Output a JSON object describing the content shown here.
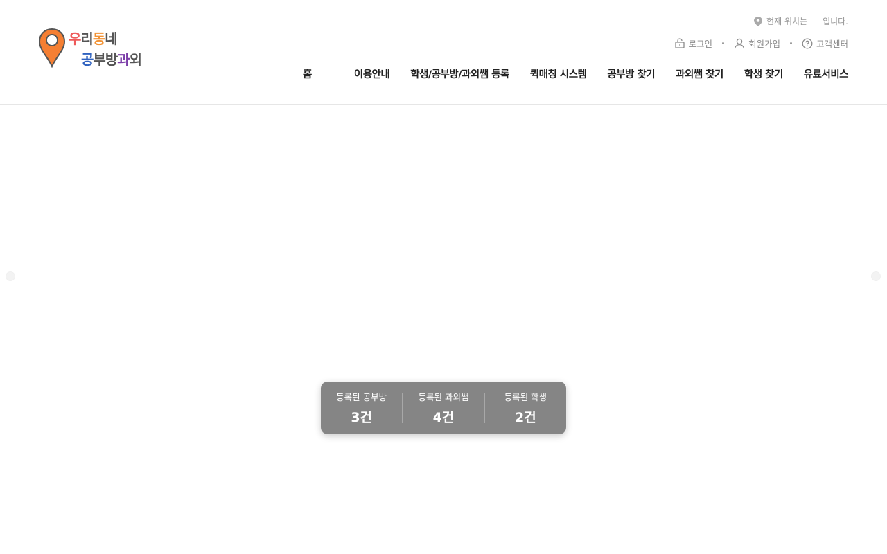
{
  "brand": {
    "line1": [
      "우",
      "리",
      "동",
      "네"
    ],
    "line2": [
      "공",
      "부",
      "방",
      "과",
      "외"
    ],
    "colors": {
      "red": "#ee5a5a",
      "orange": "#f29233",
      "blue": "#2f62c0",
      "purple": "#7b3da8",
      "gray": "#555555"
    }
  },
  "location": {
    "icon": "map-pin-icon",
    "prefix": "현재 위치는",
    "suffix": "입니다."
  },
  "util_links": [
    {
      "label": "로그인",
      "icon": "lock-icon"
    },
    {
      "label": "회원가입",
      "icon": "user-icon"
    },
    {
      "label": "고객센터",
      "icon": "question-circle-icon"
    }
  ],
  "nav": {
    "items": [
      "홈",
      "이용안내",
      "학생/공부방/과외쌤 등록",
      "퀵매칭 시스템",
      "공부방 찾기",
      "과외쌤 찾기",
      "학생 찾기",
      "유료서비스"
    ]
  },
  "stats": [
    {
      "label": "등록된 공부방",
      "value": "3건"
    },
    {
      "label": "등록된 과외쌤",
      "value": "4건"
    },
    {
      "label": "등록된 학생",
      "value": "2건"
    }
  ]
}
